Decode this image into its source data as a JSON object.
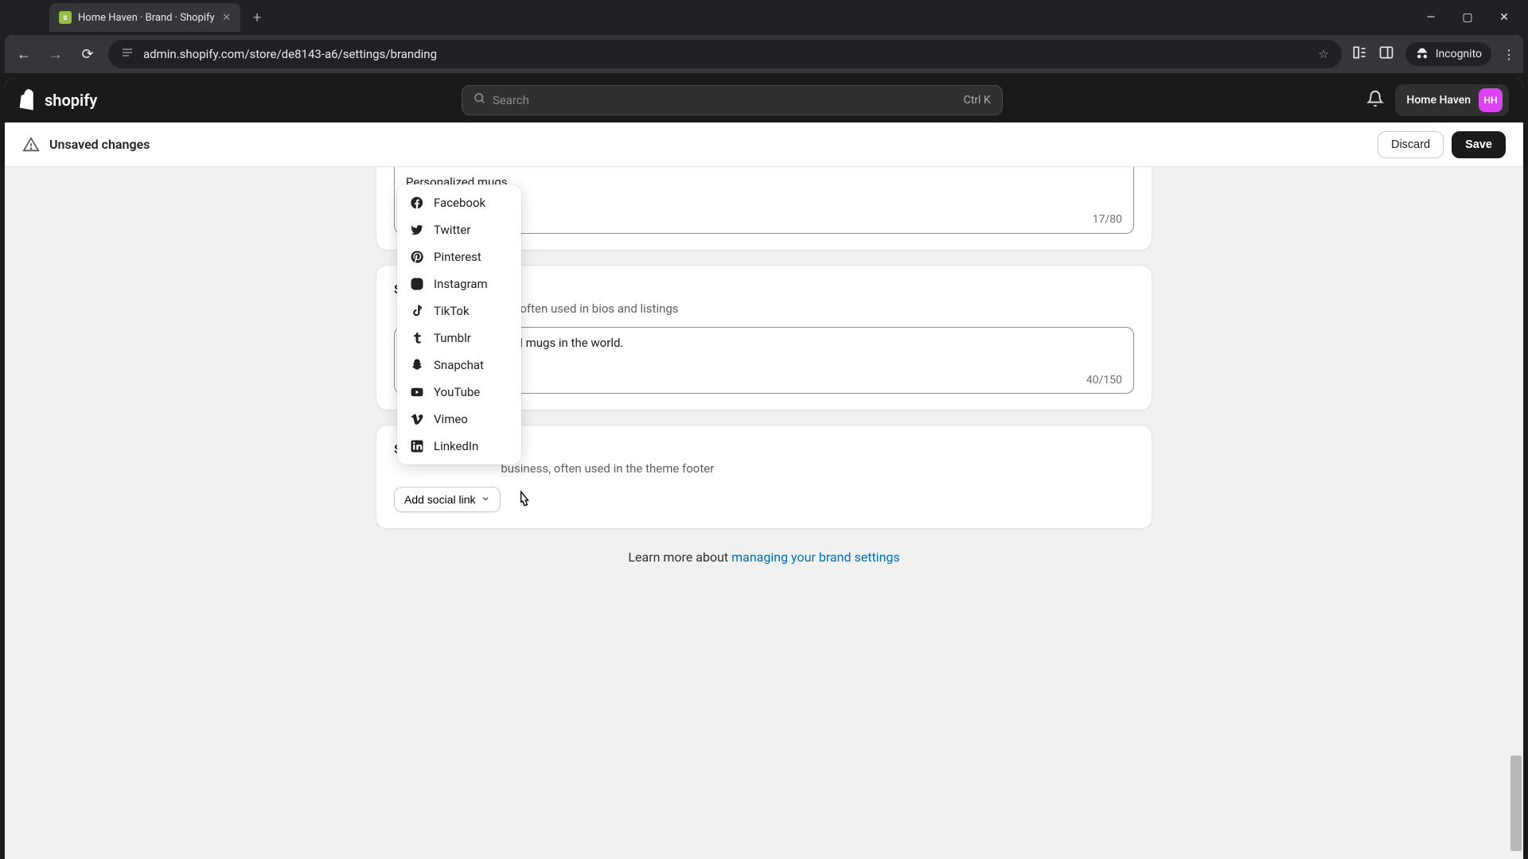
{
  "browser": {
    "tab_title": "Home Haven · Brand · Shopify",
    "url": "admin.shopify.com/store/de8143-a6/settings/branding",
    "incognito_label": "Incognito"
  },
  "topbar": {
    "search_placeholder": "Search",
    "shortcut": "Ctrl K",
    "store_name": "Home Haven",
    "store_initials": "HH"
  },
  "save_bar": {
    "message": "Unsaved changes",
    "discard": "Discard",
    "save": "Save"
  },
  "slogan": {
    "value": "Personalized mugs",
    "counter": "17/80"
  },
  "short_desc": {
    "title": "S",
    "desc_fragment": "business often used in bios and listings",
    "value_fragment": "alized mugs in the world.",
    "counter": "40/150"
  },
  "social": {
    "title": "S",
    "desc_fragment": "business, often used in the theme footer",
    "add_button": "Add social link",
    "options": [
      "Facebook",
      "Twitter",
      "Pinterest",
      "Instagram",
      "TikTok",
      "Tumblr",
      "Snapchat",
      "YouTube",
      "Vimeo",
      "LinkedIn"
    ]
  },
  "footer": {
    "learn_prefix": "Learn more about ",
    "learn_link": "managing your brand settings"
  }
}
